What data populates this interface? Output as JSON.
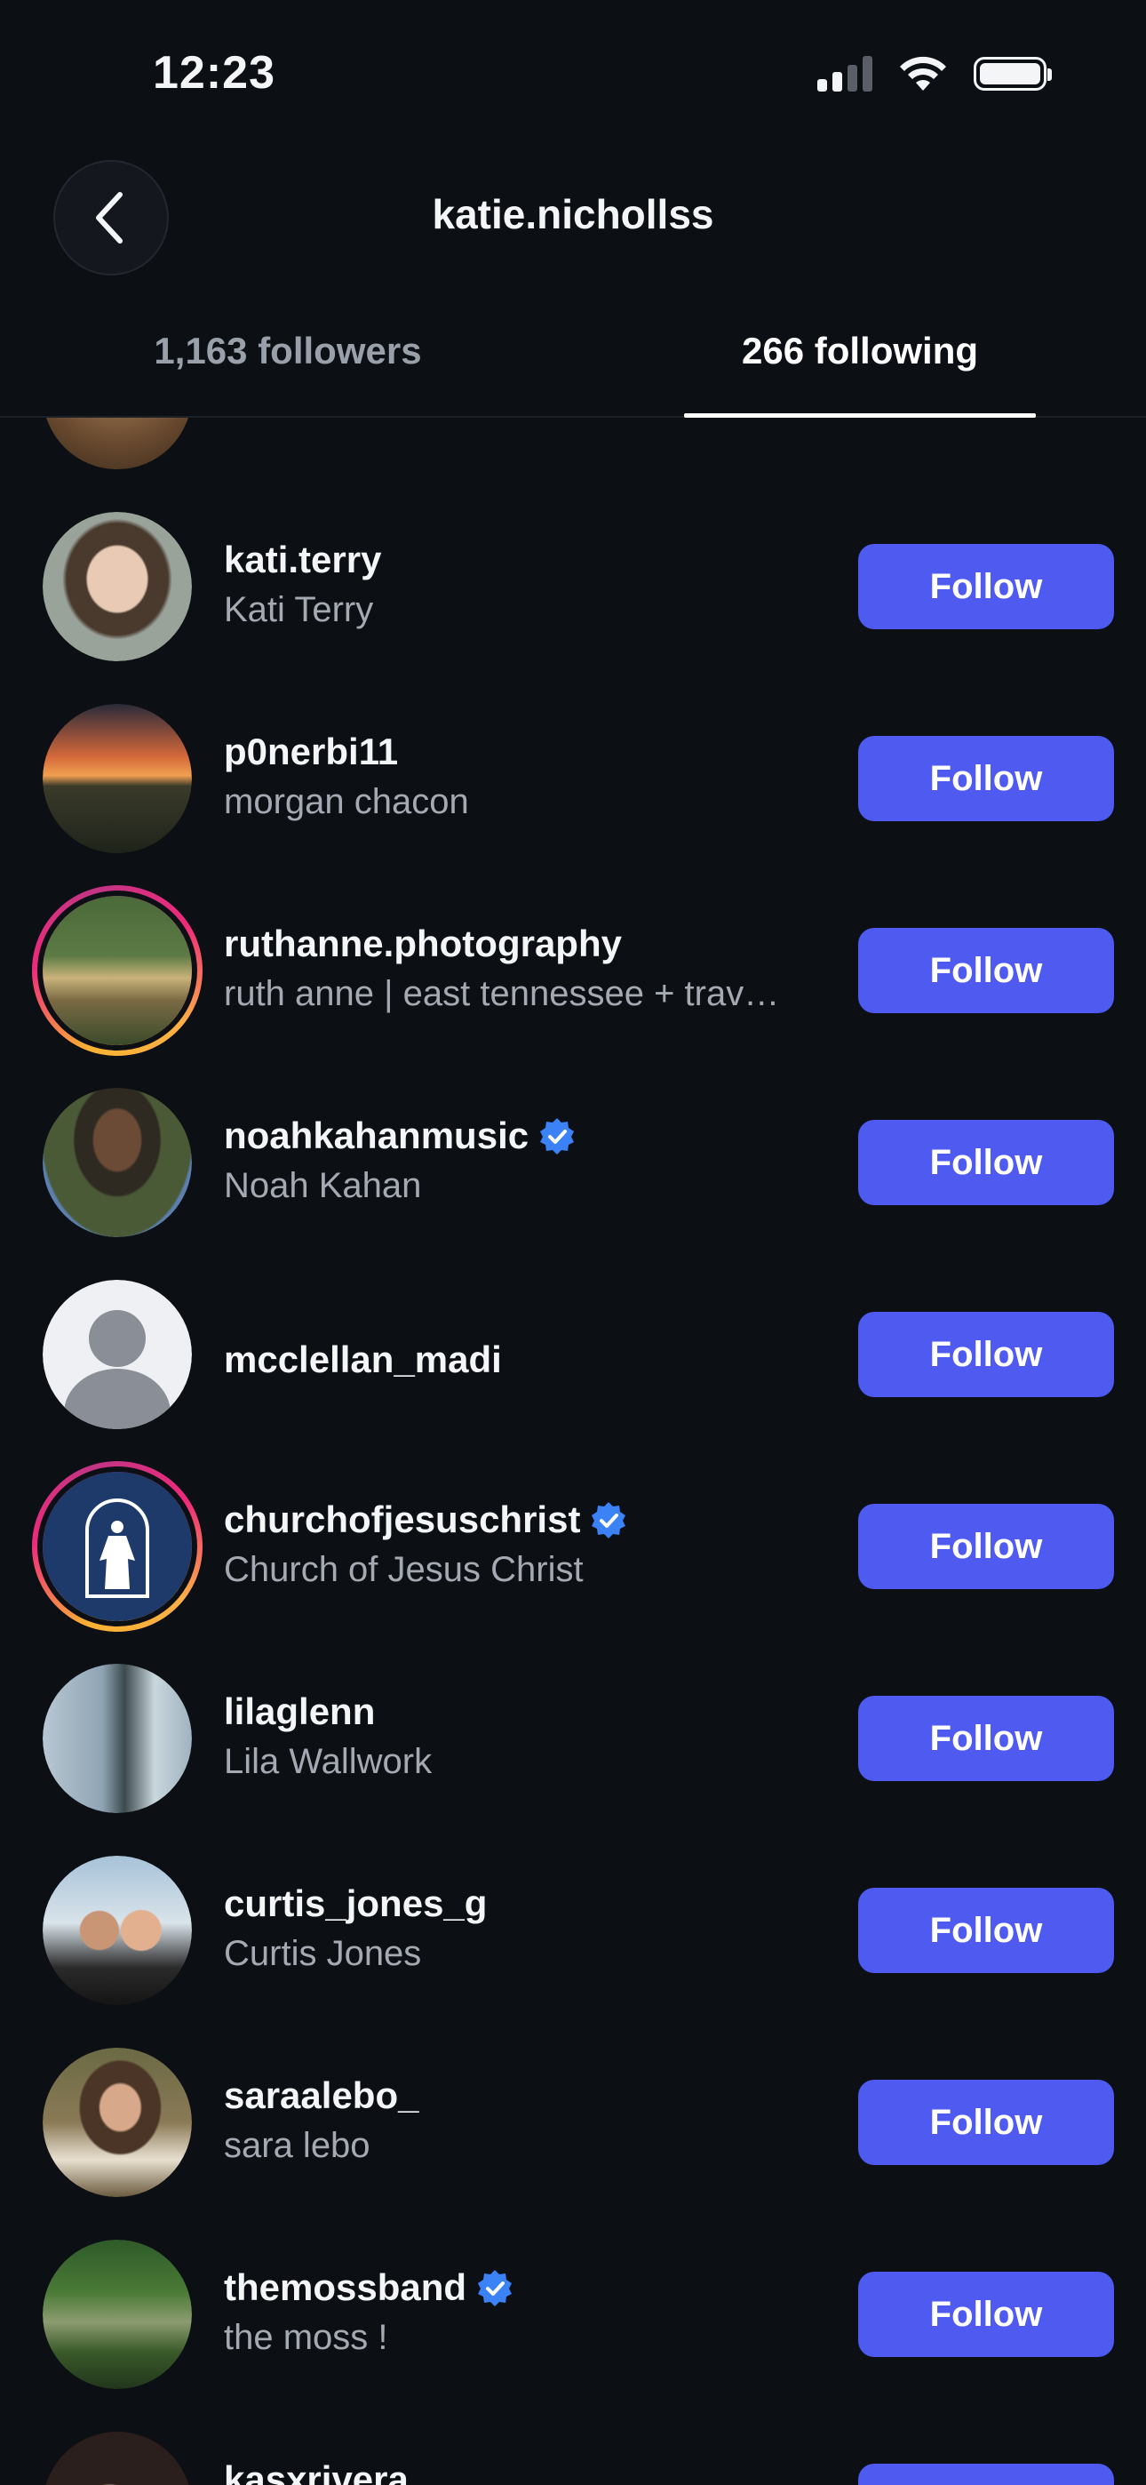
{
  "status_bar": {
    "time": "12:23"
  },
  "header": {
    "title": "katie.nichollss"
  },
  "tabs": [
    {
      "label": "1,163 followers",
      "active": false
    },
    {
      "label": "266 following",
      "active": true
    }
  ],
  "follow_label": "Follow",
  "users": [
    {
      "username": "kati.terry",
      "name": "Kati Terry",
      "verified": false,
      "story_ring": false
    },
    {
      "username": "p0nerbi11",
      "name": "morgan chacon",
      "verified": false,
      "story_ring": false
    },
    {
      "username": "ruthanne.photography",
      "name": "ruth anne | east tennessee + trav…",
      "verified": false,
      "story_ring": true
    },
    {
      "username": "noahkahanmusic",
      "name": "Noah Kahan",
      "verified": true,
      "story_ring": false
    },
    {
      "username": "mcclellan_madi",
      "name": "",
      "verified": false,
      "story_ring": false
    },
    {
      "username": "churchofjesuschrist",
      "name": "Church of Jesus Christ",
      "verified": true,
      "story_ring": true
    },
    {
      "username": "lilaglenn",
      "name": "Lila Wallwork",
      "verified": false,
      "story_ring": false
    },
    {
      "username": "curtis_jones_g",
      "name": "Curtis Jones",
      "verified": false,
      "story_ring": false
    },
    {
      "username": "saraalebo_",
      "name": "sara lebo",
      "verified": false,
      "story_ring": false
    },
    {
      "username": "themossband",
      "name": "the moss !",
      "verified": true,
      "story_ring": false
    },
    {
      "username": "kasxrivera",
      "name": "",
      "verified": false,
      "story_ring": false
    }
  ],
  "colors": {
    "background": "#0c0f14",
    "follow_button": "#4e5af0",
    "verified_badge": "#3b82f6",
    "secondary_text": "#a4a9b2"
  }
}
